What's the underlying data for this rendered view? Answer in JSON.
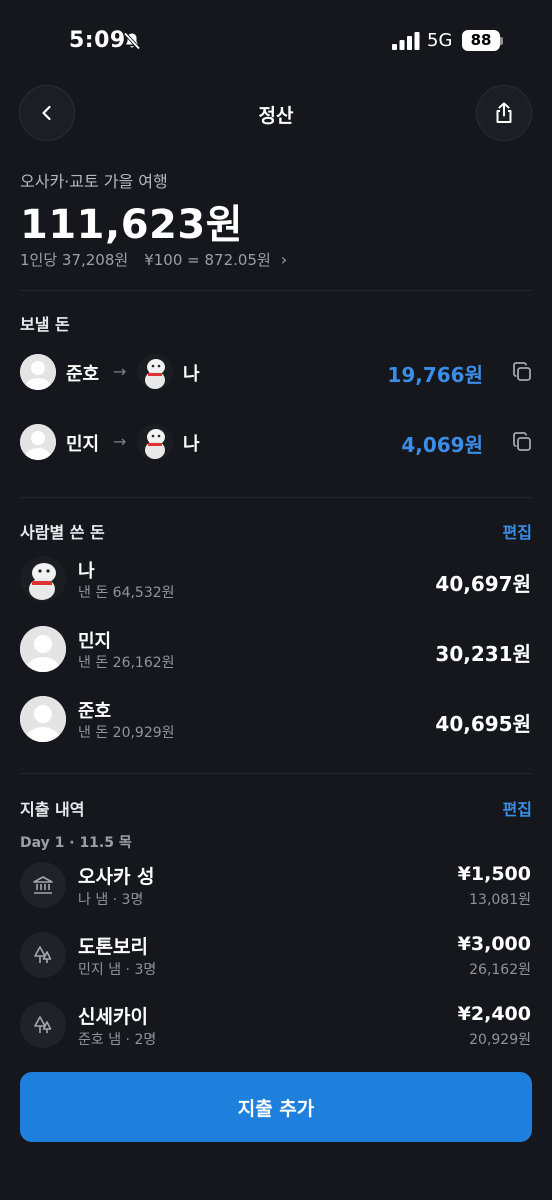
{
  "status": {
    "time": "5:09",
    "network": "5G",
    "battery": "88"
  },
  "header": {
    "title": "정산"
  },
  "summary": {
    "trip_name": "오사카·교토 가을 여행",
    "total": "111,623원",
    "per_person": "1인당 37,208원",
    "rate": "¥100 = 872.05원"
  },
  "transfers": {
    "title": "보낼 돈",
    "arrow": "→",
    "items": [
      {
        "from": "준호",
        "to": "나",
        "amount": "19,766원"
      },
      {
        "from": "민지",
        "to": "나",
        "amount": "4,069원"
      }
    ]
  },
  "by_person": {
    "title": "사람별 쓴 돈",
    "edit": "편집",
    "items": [
      {
        "name": "나",
        "paid": "낸 돈 64,532원",
        "amount": "40,697원"
      },
      {
        "name": "민지",
        "paid": "낸 돈 26,162원",
        "amount": "30,231원"
      },
      {
        "name": "준호",
        "paid": "낸 돈 20,929원",
        "amount": "40,695원"
      }
    ]
  },
  "expenses": {
    "title": "지출 내역",
    "edit": "편집",
    "day_label": "Day 1 · 11.5 목",
    "items": [
      {
        "name": "오사카 성",
        "meta": "나 냄 · 3명",
        "amount": "¥1,500",
        "krw": "13,081원",
        "icon": "landmark-icon"
      },
      {
        "name": "도톤보리",
        "meta": "민지 냄 · 3명",
        "amount": "¥3,000",
        "krw": "26,162원",
        "icon": "trees-icon"
      },
      {
        "name": "신세카이",
        "meta": "준호 냄 · 2명",
        "amount": "¥2,400",
        "krw": "20,929원",
        "icon": "trees-icon"
      }
    ]
  },
  "add_button": {
    "label": "지출 추가"
  },
  "colors": {
    "background": "#15171c",
    "accent": "#3b8ee8",
    "button": "#1f7fdc"
  }
}
